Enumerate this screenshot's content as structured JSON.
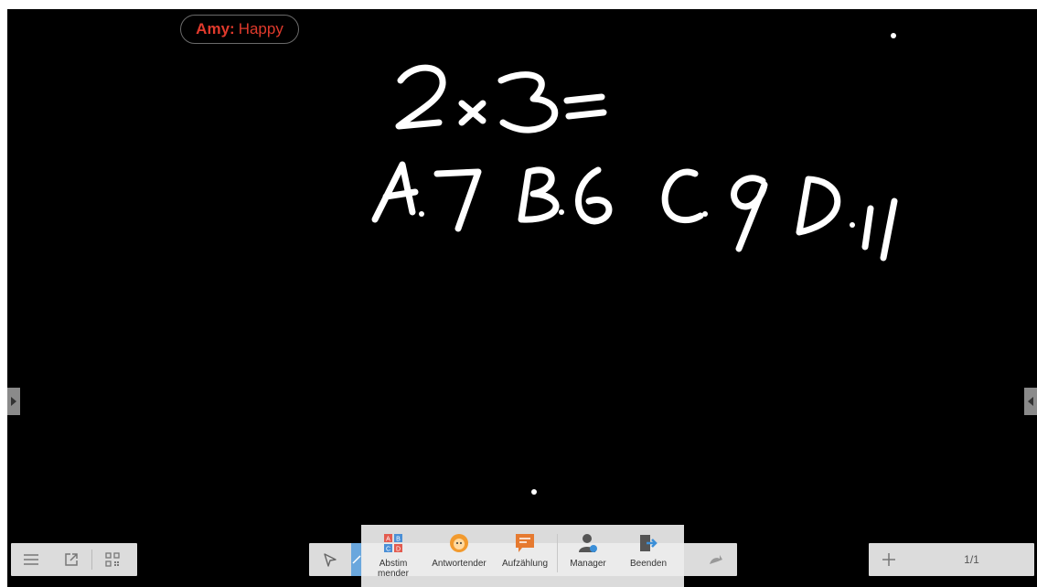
{
  "badge": {
    "name": "Amy:",
    "status": "Happy"
  },
  "board": {
    "background": "#000000",
    "handwriting": [
      "2x3 =",
      "A.7 B.6 C.9 D.11"
    ]
  },
  "popup_menu": {
    "items": [
      {
        "label": "Abstim mender",
        "icon": "abcd-vote-icon"
      },
      {
        "label": "Antwortender",
        "icon": "face-icon"
      },
      {
        "label": "Aufzählung",
        "icon": "message-icon"
      },
      {
        "label": "Manager",
        "icon": "user-gear-icon"
      },
      {
        "label": "Beenden",
        "icon": "exit-icon"
      }
    ]
  },
  "left_toolbar": {
    "icons": [
      "menu-icon",
      "share-icon",
      "qr-code-icon"
    ]
  },
  "center_toolbar": {
    "icons": [
      "select-arrow-icon",
      "pen-icon",
      "redo-icon"
    ]
  },
  "right_toolbar": {
    "add_icon": "plus-icon",
    "page_indicator": "1/1"
  },
  "colors": {
    "accent_red": "#e03a2c",
    "toolbar_bg": "#dcdcdc",
    "active_tool": "#6aa7dd"
  }
}
